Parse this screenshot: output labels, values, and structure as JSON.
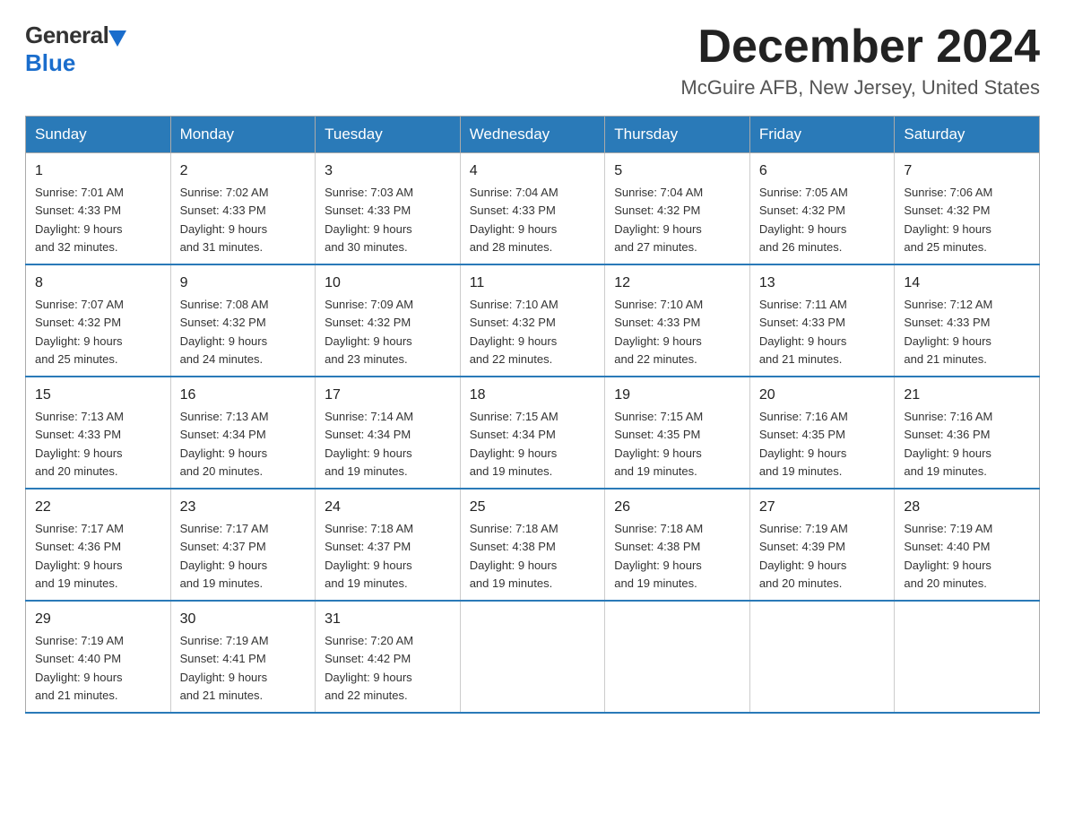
{
  "logo": {
    "general": "General",
    "blue": "Blue"
  },
  "title": "December 2024",
  "location": "McGuire AFB, New Jersey, United States",
  "days_of_week": [
    "Sunday",
    "Monday",
    "Tuesday",
    "Wednesday",
    "Thursday",
    "Friday",
    "Saturday"
  ],
  "weeks": [
    [
      {
        "day": "1",
        "sunrise": "7:01 AM",
        "sunset": "4:33 PM",
        "daylight": "9 hours and 32 minutes."
      },
      {
        "day": "2",
        "sunrise": "7:02 AM",
        "sunset": "4:33 PM",
        "daylight": "9 hours and 31 minutes."
      },
      {
        "day": "3",
        "sunrise": "7:03 AM",
        "sunset": "4:33 PM",
        "daylight": "9 hours and 30 minutes."
      },
      {
        "day": "4",
        "sunrise": "7:04 AM",
        "sunset": "4:33 PM",
        "daylight": "9 hours and 28 minutes."
      },
      {
        "day": "5",
        "sunrise": "7:04 AM",
        "sunset": "4:32 PM",
        "daylight": "9 hours and 27 minutes."
      },
      {
        "day": "6",
        "sunrise": "7:05 AM",
        "sunset": "4:32 PM",
        "daylight": "9 hours and 26 minutes."
      },
      {
        "day": "7",
        "sunrise": "7:06 AM",
        "sunset": "4:32 PM",
        "daylight": "9 hours and 25 minutes."
      }
    ],
    [
      {
        "day": "8",
        "sunrise": "7:07 AM",
        "sunset": "4:32 PM",
        "daylight": "9 hours and 25 minutes."
      },
      {
        "day": "9",
        "sunrise": "7:08 AM",
        "sunset": "4:32 PM",
        "daylight": "9 hours and 24 minutes."
      },
      {
        "day": "10",
        "sunrise": "7:09 AM",
        "sunset": "4:32 PM",
        "daylight": "9 hours and 23 minutes."
      },
      {
        "day": "11",
        "sunrise": "7:10 AM",
        "sunset": "4:32 PM",
        "daylight": "9 hours and 22 minutes."
      },
      {
        "day": "12",
        "sunrise": "7:10 AM",
        "sunset": "4:33 PM",
        "daylight": "9 hours and 22 minutes."
      },
      {
        "day": "13",
        "sunrise": "7:11 AM",
        "sunset": "4:33 PM",
        "daylight": "9 hours and 21 minutes."
      },
      {
        "day": "14",
        "sunrise": "7:12 AM",
        "sunset": "4:33 PM",
        "daylight": "9 hours and 21 minutes."
      }
    ],
    [
      {
        "day": "15",
        "sunrise": "7:13 AM",
        "sunset": "4:33 PM",
        "daylight": "9 hours and 20 minutes."
      },
      {
        "day": "16",
        "sunrise": "7:13 AM",
        "sunset": "4:34 PM",
        "daylight": "9 hours and 20 minutes."
      },
      {
        "day": "17",
        "sunrise": "7:14 AM",
        "sunset": "4:34 PM",
        "daylight": "9 hours and 19 minutes."
      },
      {
        "day": "18",
        "sunrise": "7:15 AM",
        "sunset": "4:34 PM",
        "daylight": "9 hours and 19 minutes."
      },
      {
        "day": "19",
        "sunrise": "7:15 AM",
        "sunset": "4:35 PM",
        "daylight": "9 hours and 19 minutes."
      },
      {
        "day": "20",
        "sunrise": "7:16 AM",
        "sunset": "4:35 PM",
        "daylight": "9 hours and 19 minutes."
      },
      {
        "day": "21",
        "sunrise": "7:16 AM",
        "sunset": "4:36 PM",
        "daylight": "9 hours and 19 minutes."
      }
    ],
    [
      {
        "day": "22",
        "sunrise": "7:17 AM",
        "sunset": "4:36 PM",
        "daylight": "9 hours and 19 minutes."
      },
      {
        "day": "23",
        "sunrise": "7:17 AM",
        "sunset": "4:37 PM",
        "daylight": "9 hours and 19 minutes."
      },
      {
        "day": "24",
        "sunrise": "7:18 AM",
        "sunset": "4:37 PM",
        "daylight": "9 hours and 19 minutes."
      },
      {
        "day": "25",
        "sunrise": "7:18 AM",
        "sunset": "4:38 PM",
        "daylight": "9 hours and 19 minutes."
      },
      {
        "day": "26",
        "sunrise": "7:18 AM",
        "sunset": "4:38 PM",
        "daylight": "9 hours and 19 minutes."
      },
      {
        "day": "27",
        "sunrise": "7:19 AM",
        "sunset": "4:39 PM",
        "daylight": "9 hours and 20 minutes."
      },
      {
        "day": "28",
        "sunrise": "7:19 AM",
        "sunset": "4:40 PM",
        "daylight": "9 hours and 20 minutes."
      }
    ],
    [
      {
        "day": "29",
        "sunrise": "7:19 AM",
        "sunset": "4:40 PM",
        "daylight": "9 hours and 21 minutes."
      },
      {
        "day": "30",
        "sunrise": "7:19 AM",
        "sunset": "4:41 PM",
        "daylight": "9 hours and 21 minutes."
      },
      {
        "day": "31",
        "sunrise": "7:20 AM",
        "sunset": "4:42 PM",
        "daylight": "9 hours and 22 minutes."
      },
      null,
      null,
      null,
      null
    ]
  ]
}
